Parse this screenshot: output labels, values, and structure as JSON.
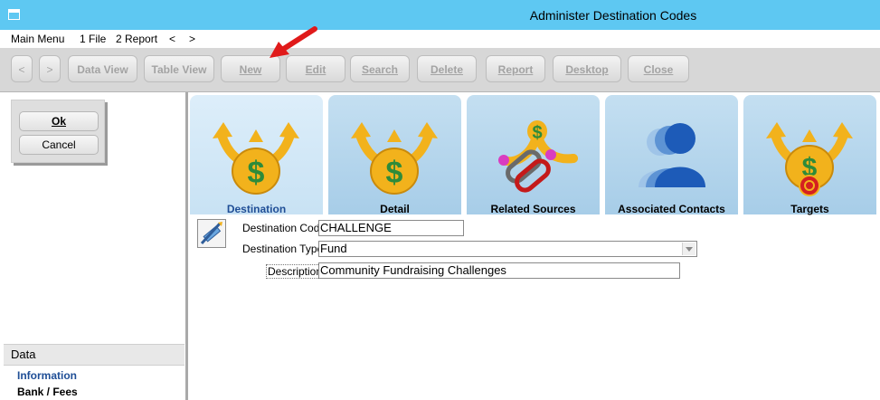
{
  "window": {
    "title": "Administer Destination Codes"
  },
  "menu": {
    "main": "Main Menu",
    "file": "1 File",
    "report": "2 Report",
    "back": "<",
    "forward": ">"
  },
  "toolbar": {
    "back": "<",
    "forward": ">",
    "data_view": "Data View",
    "table_view": "Table View",
    "new": "New",
    "edit": "Edit",
    "search": "Search",
    "delete": "Delete",
    "report": "Report",
    "desktop": "Desktop",
    "close": "Close"
  },
  "dialog": {
    "ok": "Ok",
    "cancel": "Cancel"
  },
  "sidebar": {
    "header": "Data",
    "items": [
      {
        "label": "Information",
        "color": "#1f4e96"
      },
      {
        "label": "Bank / Fees",
        "color": "#000000"
      }
    ]
  },
  "tabs": [
    {
      "label": "Destination",
      "active": true,
      "icon": "money-bag-arrows-icon"
    },
    {
      "label": "Detail",
      "active": false,
      "icon": "money-bag-arrows-icon"
    },
    {
      "label": "Related Sources",
      "active": false,
      "icon": "linked-sources-icon"
    },
    {
      "label": "Associated Contacts",
      "active": false,
      "icon": "contacts-group-icon"
    },
    {
      "label": "Targets",
      "active": false,
      "icon": "money-bag-target-icon"
    }
  ],
  "form": {
    "code_label": "Destination Code",
    "code_value": "CHALLENGE",
    "type_label": "Destination Type",
    "type_value": "Fund",
    "desc_label": "Description",
    "desc_value": "Community Fundraising Challenges"
  },
  "colors": {
    "titlebar": "#5ec8f2",
    "accent": "#1f4e96",
    "tab": "#a7cde8",
    "bag": "#f2b21c",
    "dollar": "#2e8b3a"
  }
}
